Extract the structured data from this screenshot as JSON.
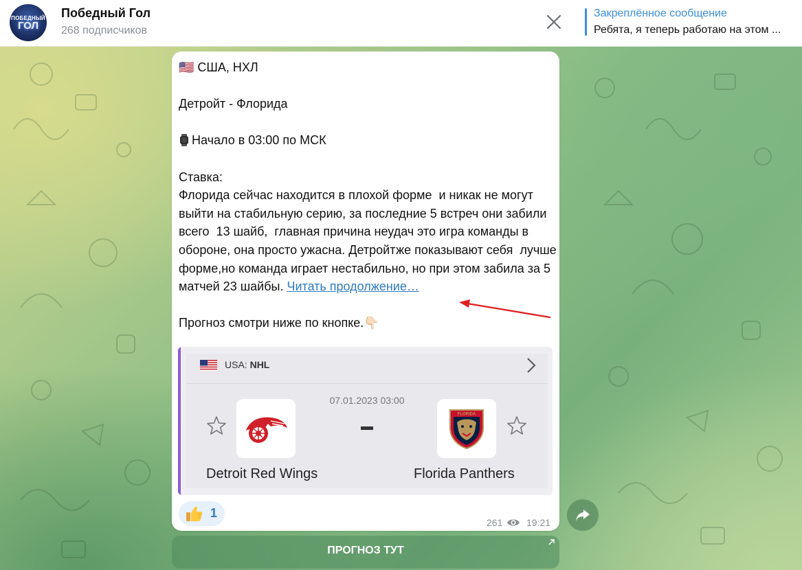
{
  "header": {
    "channel_title": "Победный Гол",
    "subscribers": "268 подписчиков",
    "avatar_text_top": "ПОБЕДНЫЙ",
    "avatar_text_bottom": "ГОЛ",
    "pinned_title": "Закреплённое сообщение",
    "pinned_text": "Ребята, я теперь работаю на этом ..."
  },
  "message": {
    "line_league": "🇺🇸 США, НХЛ",
    "line_match": "Детройт - Флорида",
    "line_start": "Начало в 03:00 по МСК",
    "line_bet_label": "Ставка:",
    "body": "Флорида сейчас находится в плохой форме  и никак не могут выйти на стабильную серию, за последние 5 встреч они забили всего  13 шайб,  главная причина неудач это игра команды в обороне, она просто ужасна. Детройтже показывают себя  лучше форме,но команда играет нестабильно, но при этом забила за 5 матчей 23 шайбы. ",
    "read_more": "Читать продолжение…",
    "forecast_line": "Прогноз смотри ниже по кнопке.",
    "forecast_emoji": "👇🏻"
  },
  "preview": {
    "country": "USA:",
    "league": "NHL",
    "date": "07.01.2023 03:00",
    "score_sep": "-",
    "home_team": "Detroit Red Wings",
    "away_team": "Florida Panthers",
    "away_logo_text": "FLORIDA"
  },
  "reaction": {
    "emoji": "thumbs-up",
    "count": "1"
  },
  "meta": {
    "views": "261",
    "time": "19:21"
  },
  "inline_button": {
    "label": "ПРОГНОЗ ТУТ"
  },
  "colors": {
    "accent": "#3a8fd9",
    "link": "#2f7bc0",
    "preview_accent": "#8b5cd6",
    "annotation_arrow": "#e02020"
  }
}
